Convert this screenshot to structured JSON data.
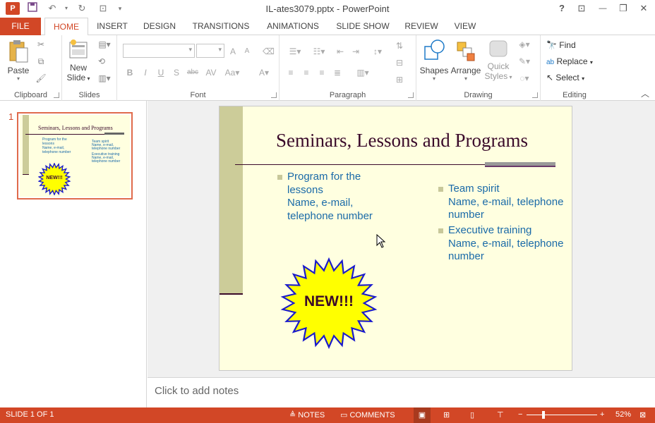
{
  "window": {
    "title": "IL-ates3079.pptx - PowerPoint",
    "help": "?",
    "restore_ribbon": "⊡",
    "minimize": "—",
    "maximize": "❐",
    "close": "✕"
  },
  "app_logo": "P",
  "tabs": {
    "file": "FILE",
    "home": "HOME",
    "insert": "INSERT",
    "design": "DESIGN",
    "transitions": "TRANSITIONS",
    "animations": "ANIMATIONS",
    "slideshow": "SLIDE SHOW",
    "review": "REVIEW",
    "view": "VIEW"
  },
  "ribbon": {
    "clipboard": {
      "label": "Clipboard",
      "paste": "Paste"
    },
    "slides": {
      "label": "Slides",
      "new_slide_1": "New",
      "new_slide_2": "Slide"
    },
    "font": {
      "label": "Font"
    },
    "paragraph": {
      "label": "Paragraph"
    },
    "drawing": {
      "label": "Drawing",
      "shapes": "Shapes",
      "arrange": "Arrange",
      "quick_styles_1": "Quick",
      "quick_styles_2": "Styles"
    },
    "editing": {
      "label": "Editing",
      "find": "Find",
      "replace": "Replace",
      "select": "Select"
    }
  },
  "thumbnail": {
    "number": "1",
    "title": "Seminars, Lessons and Programs",
    "left_bullet": "Program for the lessons\nName, e-mail, telephone number",
    "right_bullet_1": "Team spirit\nName, e-mail, telephone number",
    "right_bullet_2": "Executive training\nName, e-mail, telephone number",
    "badge": "NEW!!!"
  },
  "slide": {
    "title": "Seminars, Lessons and Programs",
    "left_bullet_line1": "Program for the",
    "left_bullet_line2": "lessons",
    "left_bullet_line3": "Name, e-mail,",
    "left_bullet_line4": "telephone number",
    "right_bullet1_line1": "Team spirit",
    "right_bullet1_line2": "Name, e-mail, telephone",
    "right_bullet1_line3": "number",
    "right_bullet2_line1": "Executive training",
    "right_bullet2_line2": "Name, e-mail, telephone",
    "right_bullet2_line3": "number",
    "badge": "NEW!!!"
  },
  "notes_placeholder": "Click to add notes",
  "status": {
    "slide_info": "SLIDE 1 OF 1",
    "notes": "NOTES",
    "comments": "COMMENTS",
    "zoom": "52%"
  },
  "colors": {
    "accent": "#d24726",
    "slide_bg": "#ffffe0",
    "slide_side_bar": "#cccc99",
    "title_color": "#3a0a2a",
    "text_color": "#1a6aa8",
    "badge_fill": "#ffff00",
    "badge_stroke": "#1a1acc"
  }
}
